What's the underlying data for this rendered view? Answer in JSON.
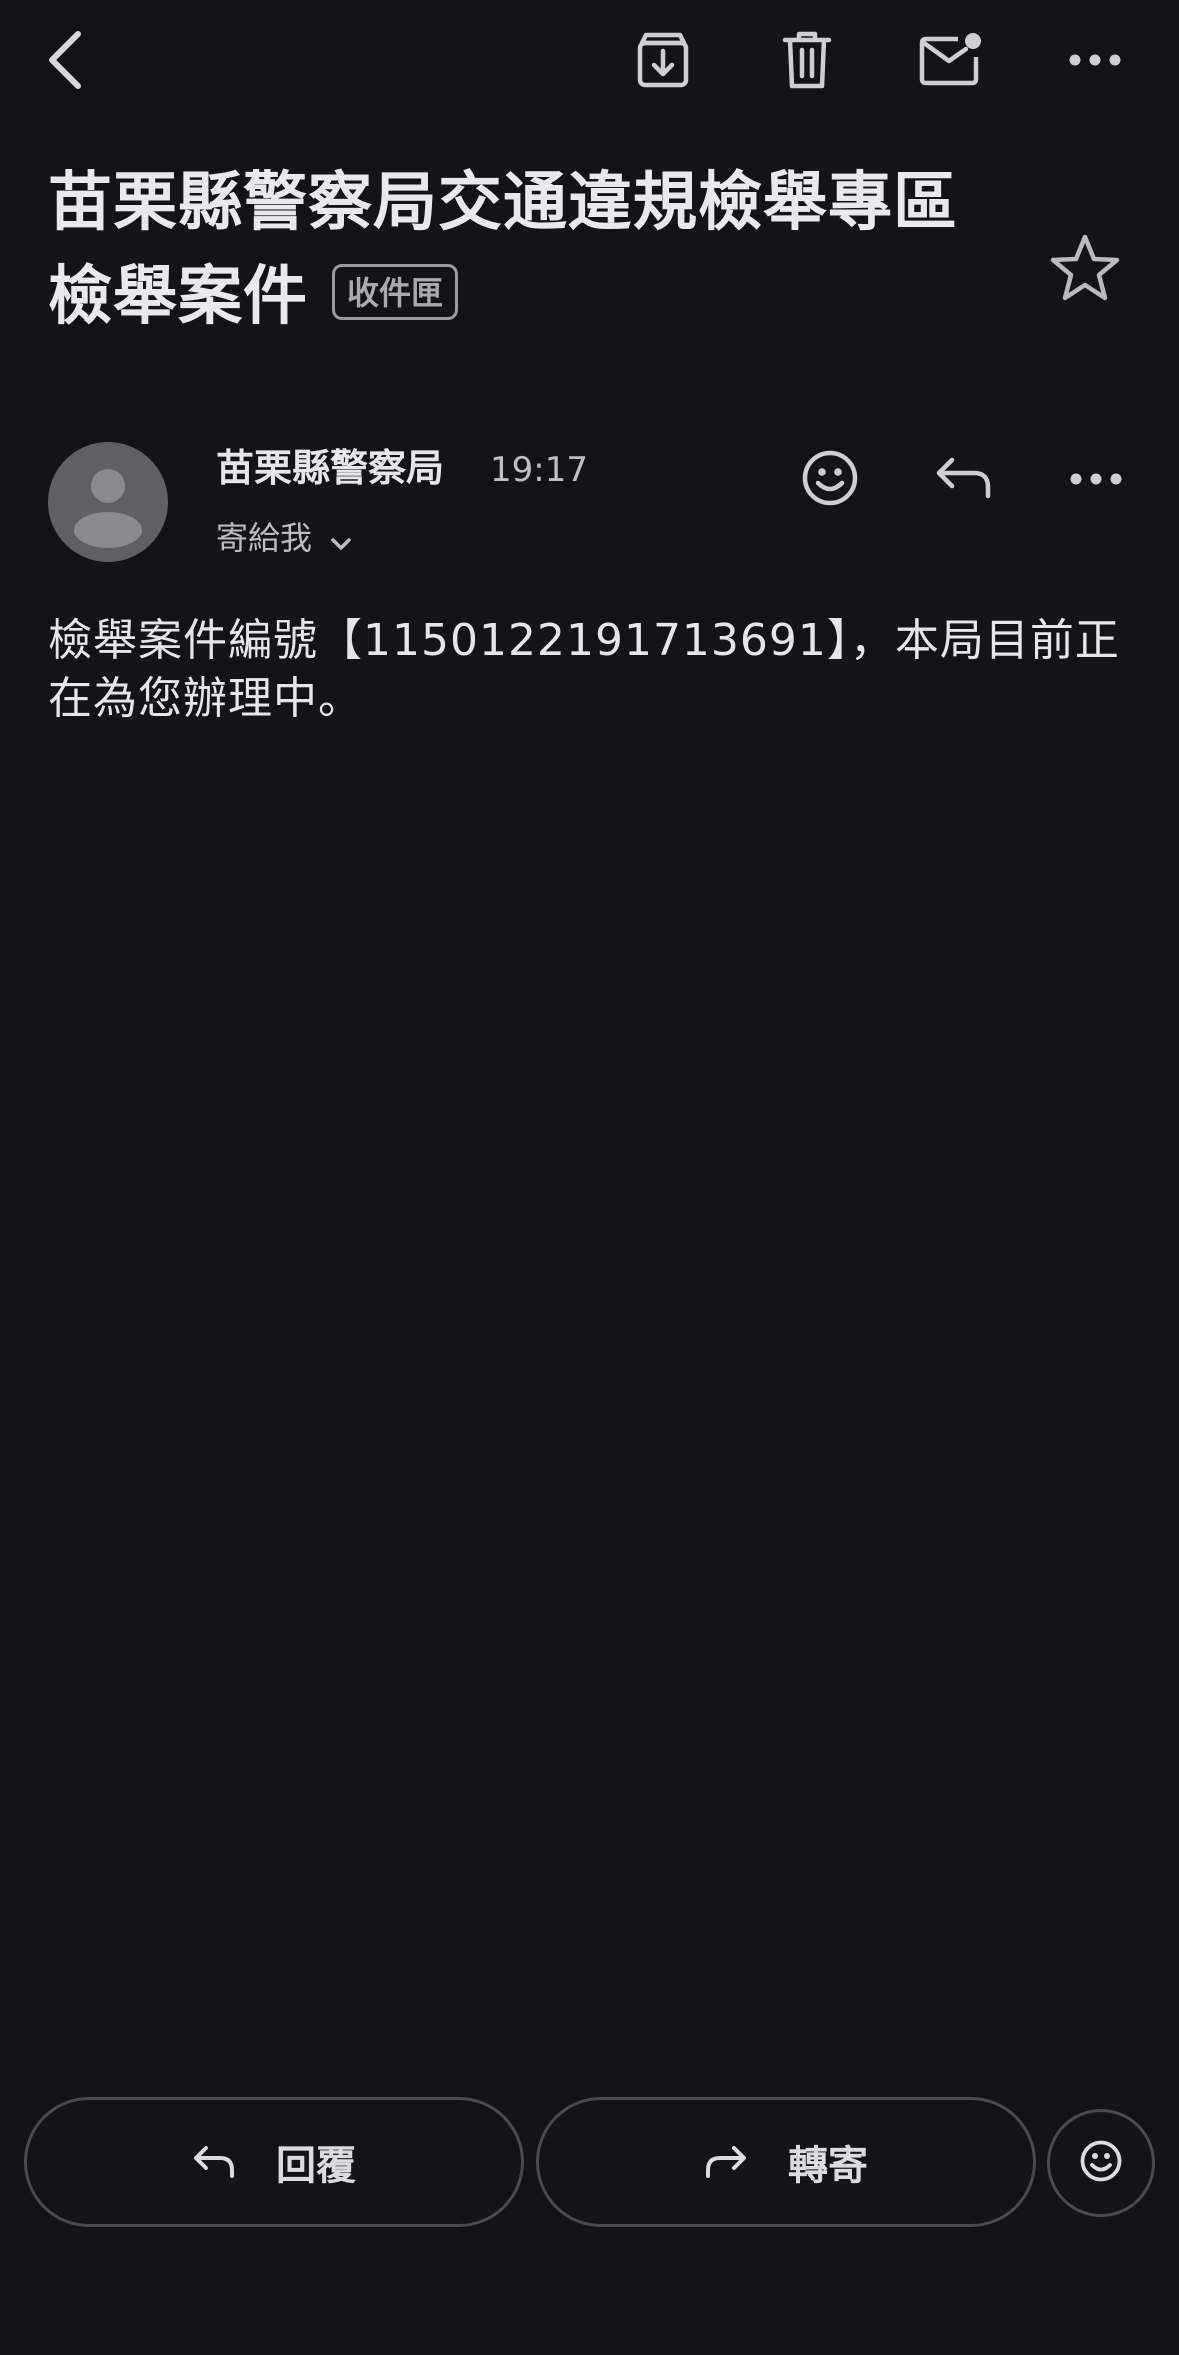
{
  "subject": {
    "line1": "苗栗縣警察局交通違規檢舉專區",
    "line2": "檢舉案件",
    "label": "收件匣"
  },
  "sender": {
    "name": "苗栗縣警察局",
    "time": "19:17",
    "to": "寄給我"
  },
  "message": {
    "body": "檢舉案件編號【1150122191713691】，本局目前正在為您辦理中。"
  },
  "actions": {
    "reply_label": "回覆",
    "forward_label": "轉寄"
  },
  "icons": {
    "back": "chevron-left-icon",
    "archive": "archive-icon",
    "delete": "trash-icon",
    "mark_unread": "mail-unread-icon",
    "more": "more-horizontal-icon",
    "star": "star-outline-icon",
    "emoji": "smiley-icon",
    "reply": "reply-icon",
    "forward": "forward-icon"
  },
  "colors": {
    "background": "#141416",
    "text": "#e6e6e8",
    "muted": "#bdbdc1",
    "avatar": "#5f6064"
  }
}
